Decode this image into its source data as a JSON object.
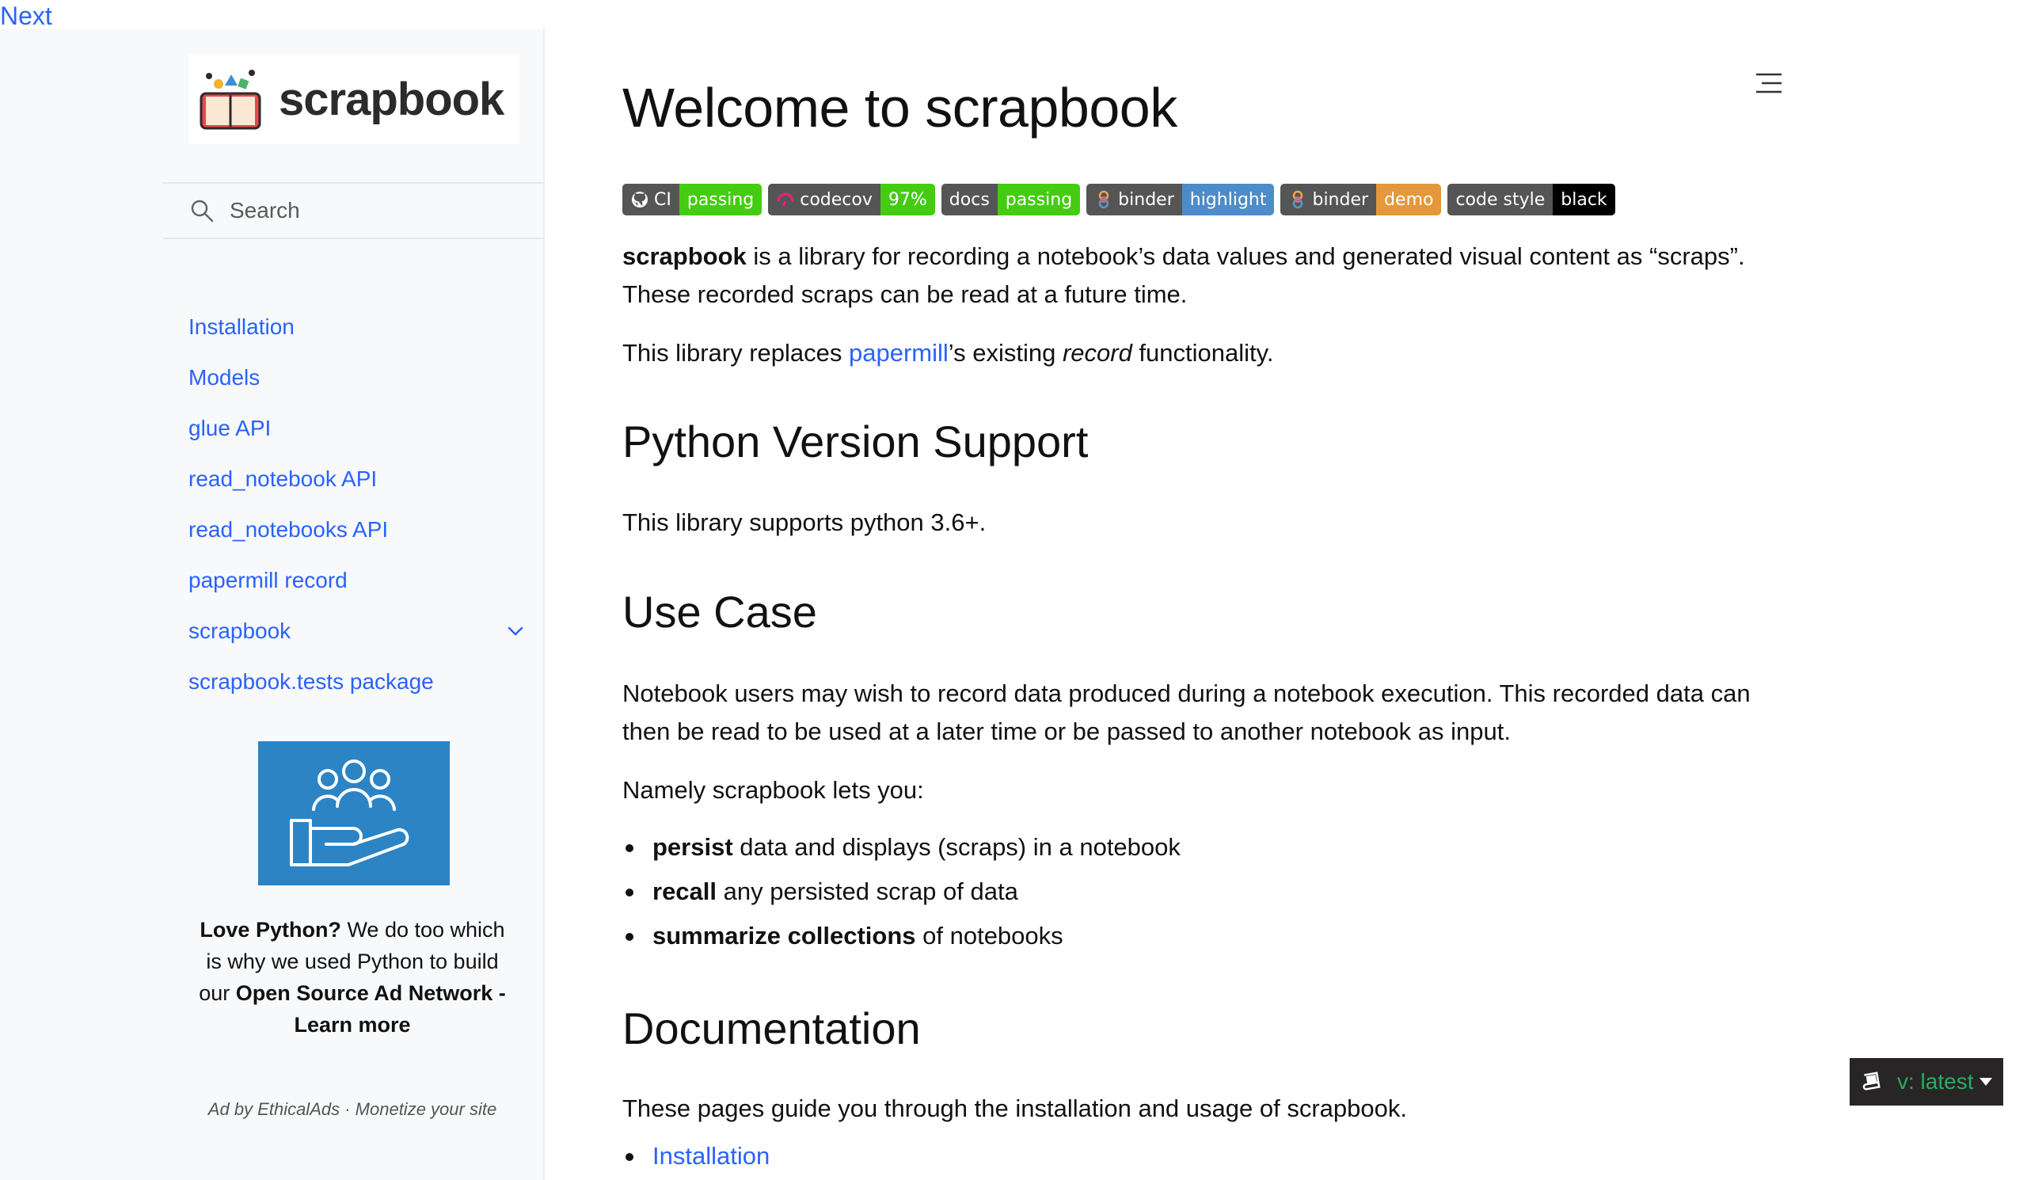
{
  "nav_top": {
    "next_label": "Next"
  },
  "sidebar": {
    "logo_text": "scrapbook",
    "search_placeholder": "Search",
    "items": [
      {
        "label": "Installation"
      },
      {
        "label": "Models"
      },
      {
        "label": "glue API"
      },
      {
        "label": "read_notebook API"
      },
      {
        "label": "read_notebooks API"
      },
      {
        "label": "papermill record"
      },
      {
        "label": "scrapbook",
        "expandable": true
      },
      {
        "label": "scrapbook.tests package"
      }
    ],
    "ad": {
      "line1_bold": "Love Python?",
      "line1_rest": " We do too which is why we used Python to build our ",
      "line2_bold": "Open Source Ad Network - Learn more",
      "footer": "Ad by EthicalAds   ·   Monetize your site"
    }
  },
  "main": {
    "title": "Welcome to scrapbook",
    "badges": [
      {
        "left": "CI",
        "right": "passing",
        "right_color": "#44cc11",
        "icon": "github-icon"
      },
      {
        "left": "codecov",
        "right": "97%",
        "right_color": "#4c1",
        "icon": "codecov-icon"
      },
      {
        "left": "docs",
        "right": "passing",
        "right_color": "#44cc11",
        "icon": ""
      },
      {
        "left": "binder",
        "right": "highlight",
        "right_color": "#4c8cc8",
        "icon": "binder-icon"
      },
      {
        "left": "binder",
        "right": "demo",
        "right_color": "#e4983b",
        "icon": "binder-icon"
      },
      {
        "left": "code style",
        "right": "black",
        "right_color": "#000000",
        "icon": ""
      }
    ],
    "intro_bold": "scrapbook",
    "intro_rest": " is a library for recording a notebook’s data values and generated visual content as “scraps”. These recorded scraps can be read at a future time.",
    "replaces_pre": "This library replaces ",
    "replaces_link": "papermill",
    "replaces_mid": "’s existing ",
    "replaces_em": "record",
    "replaces_post": " functionality.",
    "h_python": "Python Version Support",
    "python_text": "This library supports python 3.6+.",
    "h_usecase": "Use Case",
    "usecase_text": "Notebook users may wish to record data produced during a notebook execution. This recorded data can then be read to be used at a later time or be passed to another notebook as input.",
    "namely_text": "Namely scrapbook lets you:",
    "bullets": [
      {
        "bold": "persist",
        "rest": " data and displays (scraps) in a notebook"
      },
      {
        "bold": "recall",
        "rest": " any persisted scrap of data"
      },
      {
        "bold": "summarize collections",
        "rest": " of notebooks"
      }
    ],
    "h_docs": "Documentation",
    "docs_text": "These pages guide you through the installation and usage of scrapbook.",
    "docs_links": [
      {
        "label": "Installation"
      }
    ]
  },
  "version_badge": {
    "label": "v: latest"
  },
  "colors": {
    "link": "#2962ff",
    "version_green": "#27ae60",
    "sidebar_bg": "#f8f9fb",
    "ad_blue": "#2c84c5"
  }
}
